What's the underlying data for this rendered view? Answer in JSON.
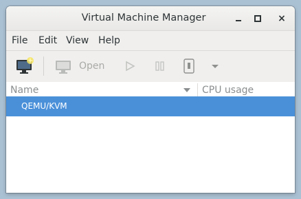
{
  "window": {
    "title": "Virtual Machine Manager",
    "controls": {
      "minimize": "minimize",
      "maximize": "maximize",
      "close": "×"
    }
  },
  "menu": {
    "items": [
      {
        "label": "File"
      },
      {
        "label": "Edit"
      },
      {
        "label": "View"
      },
      {
        "label": "Help"
      }
    ]
  },
  "toolbar": {
    "new_vm_icon": "new-vm-icon",
    "open_icon": "monitor-icon",
    "open_label": "Open",
    "run_icon": "play-icon",
    "pause_icon": "pause-icon",
    "shutdown_icon": "power-icon",
    "more_icon": "chevron-down-icon"
  },
  "table": {
    "columns": [
      {
        "label": "Name"
      },
      {
        "label": "CPU usage"
      }
    ],
    "rows": [
      {
        "name": "QEMU/KVM",
        "selected": true
      }
    ]
  },
  "colors": {
    "selection": "#4a90d9",
    "desktop": "#aac1d3",
    "disabled_text": "#a9aaa6"
  }
}
